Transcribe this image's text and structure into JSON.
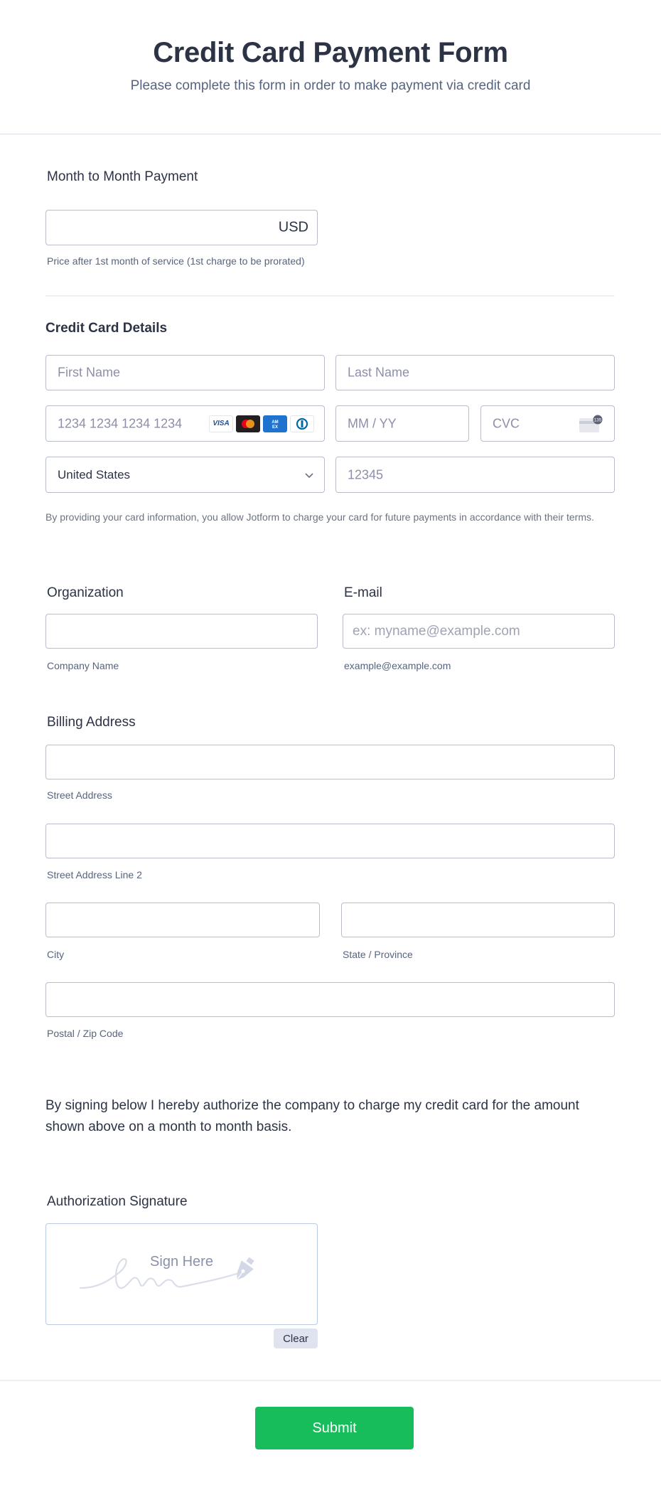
{
  "header": {
    "title": "Credit Card Payment Form",
    "subtitle": "Please complete this form in order to make payment via credit card"
  },
  "payment": {
    "label": "Month to Month Payment",
    "value": "",
    "currency": "USD",
    "helper": "Price after 1st month of service (1st charge to be prorated)"
  },
  "credit_card": {
    "title": "Credit Card Details",
    "first_name_placeholder": "First Name",
    "last_name_placeholder": "Last Name",
    "card_number_placeholder": "1234 1234 1234 1234",
    "card_brands": [
      "VISA",
      "Mastercard",
      "AMEX",
      "Diners Club"
    ],
    "expiry_placeholder": "MM / YY",
    "cvc_placeholder": "CVC",
    "cvc_icon_number": "135",
    "country": "United States",
    "zip_placeholder": "12345",
    "disclaimer": "By providing your card information, you allow Jotform to charge your card for future payments in accordance with their terms."
  },
  "organization": {
    "label": "Organization",
    "value": "",
    "helper": "Company Name"
  },
  "email": {
    "label": "E-mail",
    "placeholder": "ex: myname@example.com",
    "helper": "example@example.com"
  },
  "billing": {
    "label": "Billing Address",
    "street_helper": "Street Address",
    "street2_helper": "Street Address Line 2",
    "city_helper": "City",
    "state_helper": "State / Province",
    "postal_helper": "Postal / Zip Code"
  },
  "authorization": {
    "text": "By signing below I hereby authorize the company to charge my credit card for the amount shown above on a month to month basis.",
    "signature_label": "Authorization Signature",
    "sign_placeholder": "Sign Here",
    "clear_label": "Clear"
  },
  "submit_label": "Submit",
  "colors": {
    "submit": "#18bd5b",
    "text": "#2c3345",
    "muted": "#57647e",
    "border": "#b8bdc9"
  }
}
